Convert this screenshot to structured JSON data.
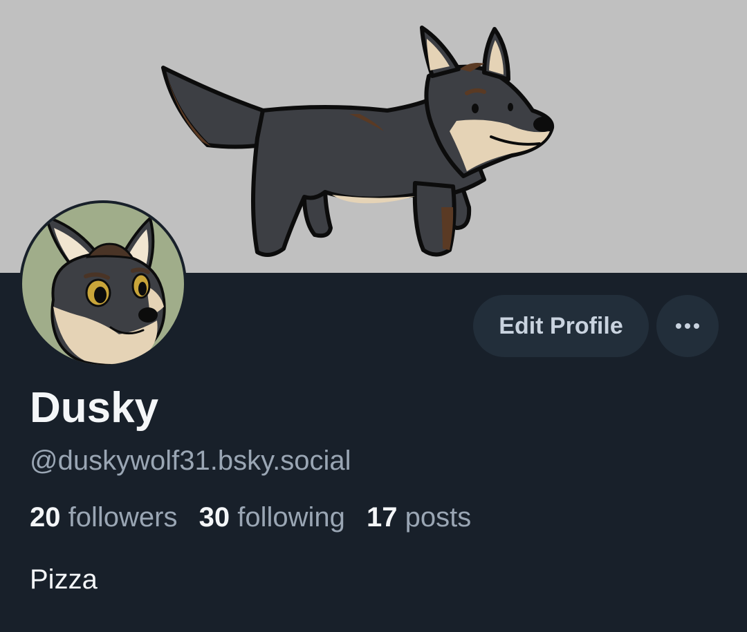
{
  "profile": {
    "display_name": "Dusky",
    "handle": "@duskywolf31.bsky.social",
    "bio": "Pizza"
  },
  "actions": {
    "edit_profile_label": "Edit Profile",
    "more_icon": "ellipsis-icon"
  },
  "stats": {
    "followers": {
      "count": "20",
      "label": "followers"
    },
    "following": {
      "count": "30",
      "label": "following"
    },
    "posts": {
      "count": "17",
      "label": "posts"
    }
  },
  "colors": {
    "background": "#18202a",
    "banner": "#c0c0c0",
    "button": "#222e3a",
    "primary_text": "#f4f6f8",
    "secondary_text": "#9aa6b4"
  }
}
